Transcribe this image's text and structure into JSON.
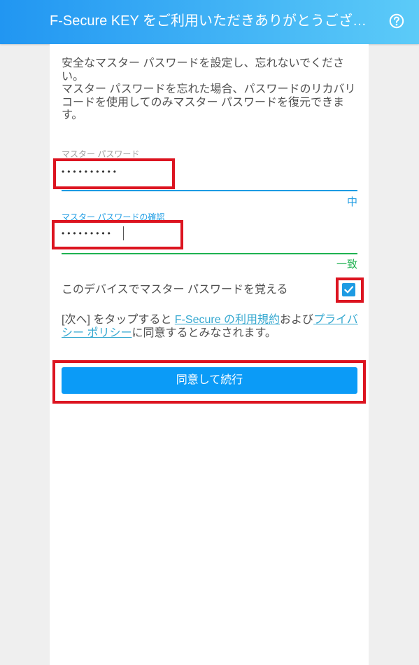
{
  "header": {
    "title": "F-Secure KEY をご利用いただきありがとうござ…",
    "help_icon": "help-circle-icon"
  },
  "intro": {
    "paragraph1": "安全なマスター パスワードを設定し、忘れないでください。",
    "paragraph2": "マスター パスワードを忘れた場合、パスワードのリカバリコードを使用してのみマスター パスワードを復元できます。"
  },
  "password": {
    "label": "マスター パスワード",
    "masked_value": "••••••••••",
    "strength": "中"
  },
  "confirm": {
    "label": "マスター パスワードの確認",
    "masked_value": "•••••••••",
    "match_status": "一致"
  },
  "remember": {
    "label": "このデバイスでマスター パスワードを覚える",
    "checked": true,
    "checkbox_icon": "checkmark-icon"
  },
  "terms": {
    "prefix": "[次へ] をタップすると ",
    "terms_link": "F-Secure の利用規約",
    "middle": "および",
    "privacy_link": "プライバシー ポリシー",
    "suffix": "に同意するとみなされます。"
  },
  "continue_button": {
    "label": "同意して続行"
  },
  "colors": {
    "header_start": "#2196f2",
    "header_end": "#5ccbf8",
    "accent_blue": "#1d9be3",
    "match_green": "#1fb251",
    "link": "#35a8d0",
    "button": "#0b9bf7",
    "highlight_red": "#dc1420",
    "text": "#505050"
  }
}
